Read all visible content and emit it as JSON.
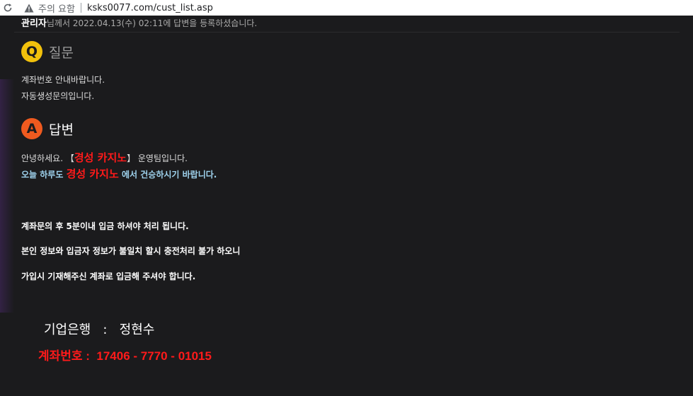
{
  "browser": {
    "warning_label": "주의 요함",
    "url": "ksks0077.com/cust_list.asp"
  },
  "header": {
    "author": "관리자",
    "meta": "님께서 2022.04.13(수) 02:11에 답변을 등록하셨습니다."
  },
  "question": {
    "badge": "Q",
    "title": "질문",
    "lines": [
      "계좌번호 안내바랍니다.",
      "자동생성문의입니다."
    ]
  },
  "answer": {
    "badge": "A",
    "title": "답변",
    "greeting_prefix": "안녕하세요. 【",
    "brand": "경성 카지노",
    "greeting_suffix": "】 운영팀입니다.",
    "today_prefix": "오늘 하루도 ",
    "today_suffix": " 에서 건승하시기 바랍니다.",
    "notice1": "계좌문의 후 5분이내 입금 하셔야 처리 됩니다.",
    "notice2": "본인 정보와 입금자 정보가 불일치 할시 충전처리 불가 하오니",
    "notice3": "가입시 기재해주신 계좌로 입금해 주셔야 합니다.",
    "bank_line": "기업은행   :   정현수",
    "account_line": "계좌번호 :  17406 - 7770 - 01015"
  }
}
